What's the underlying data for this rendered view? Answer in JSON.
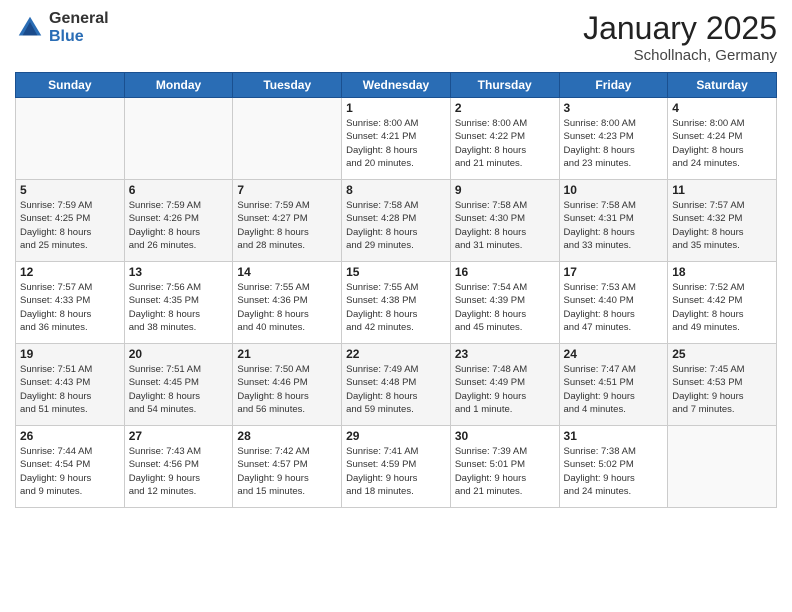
{
  "logo": {
    "general": "General",
    "blue": "Blue"
  },
  "header": {
    "title": "January 2025",
    "subtitle": "Schollnach, Germany"
  },
  "days_of_week": [
    "Sunday",
    "Monday",
    "Tuesday",
    "Wednesday",
    "Thursday",
    "Friday",
    "Saturday"
  ],
  "weeks": [
    [
      {
        "day": "",
        "info": ""
      },
      {
        "day": "",
        "info": ""
      },
      {
        "day": "",
        "info": ""
      },
      {
        "day": "1",
        "info": "Sunrise: 8:00 AM\nSunset: 4:21 PM\nDaylight: 8 hours\nand 20 minutes."
      },
      {
        "day": "2",
        "info": "Sunrise: 8:00 AM\nSunset: 4:22 PM\nDaylight: 8 hours\nand 21 minutes."
      },
      {
        "day": "3",
        "info": "Sunrise: 8:00 AM\nSunset: 4:23 PM\nDaylight: 8 hours\nand 23 minutes."
      },
      {
        "day": "4",
        "info": "Sunrise: 8:00 AM\nSunset: 4:24 PM\nDaylight: 8 hours\nand 24 minutes."
      }
    ],
    [
      {
        "day": "5",
        "info": "Sunrise: 7:59 AM\nSunset: 4:25 PM\nDaylight: 8 hours\nand 25 minutes."
      },
      {
        "day": "6",
        "info": "Sunrise: 7:59 AM\nSunset: 4:26 PM\nDaylight: 8 hours\nand 26 minutes."
      },
      {
        "day": "7",
        "info": "Sunrise: 7:59 AM\nSunset: 4:27 PM\nDaylight: 8 hours\nand 28 minutes."
      },
      {
        "day": "8",
        "info": "Sunrise: 7:58 AM\nSunset: 4:28 PM\nDaylight: 8 hours\nand 29 minutes."
      },
      {
        "day": "9",
        "info": "Sunrise: 7:58 AM\nSunset: 4:30 PM\nDaylight: 8 hours\nand 31 minutes."
      },
      {
        "day": "10",
        "info": "Sunrise: 7:58 AM\nSunset: 4:31 PM\nDaylight: 8 hours\nand 33 minutes."
      },
      {
        "day": "11",
        "info": "Sunrise: 7:57 AM\nSunset: 4:32 PM\nDaylight: 8 hours\nand 35 minutes."
      }
    ],
    [
      {
        "day": "12",
        "info": "Sunrise: 7:57 AM\nSunset: 4:33 PM\nDaylight: 8 hours\nand 36 minutes."
      },
      {
        "day": "13",
        "info": "Sunrise: 7:56 AM\nSunset: 4:35 PM\nDaylight: 8 hours\nand 38 minutes."
      },
      {
        "day": "14",
        "info": "Sunrise: 7:55 AM\nSunset: 4:36 PM\nDaylight: 8 hours\nand 40 minutes."
      },
      {
        "day": "15",
        "info": "Sunrise: 7:55 AM\nSunset: 4:38 PM\nDaylight: 8 hours\nand 42 minutes."
      },
      {
        "day": "16",
        "info": "Sunrise: 7:54 AM\nSunset: 4:39 PM\nDaylight: 8 hours\nand 45 minutes."
      },
      {
        "day": "17",
        "info": "Sunrise: 7:53 AM\nSunset: 4:40 PM\nDaylight: 8 hours\nand 47 minutes."
      },
      {
        "day": "18",
        "info": "Sunrise: 7:52 AM\nSunset: 4:42 PM\nDaylight: 8 hours\nand 49 minutes."
      }
    ],
    [
      {
        "day": "19",
        "info": "Sunrise: 7:51 AM\nSunset: 4:43 PM\nDaylight: 8 hours\nand 51 minutes."
      },
      {
        "day": "20",
        "info": "Sunrise: 7:51 AM\nSunset: 4:45 PM\nDaylight: 8 hours\nand 54 minutes."
      },
      {
        "day": "21",
        "info": "Sunrise: 7:50 AM\nSunset: 4:46 PM\nDaylight: 8 hours\nand 56 minutes."
      },
      {
        "day": "22",
        "info": "Sunrise: 7:49 AM\nSunset: 4:48 PM\nDaylight: 8 hours\nand 59 minutes."
      },
      {
        "day": "23",
        "info": "Sunrise: 7:48 AM\nSunset: 4:49 PM\nDaylight: 9 hours\nand 1 minute."
      },
      {
        "day": "24",
        "info": "Sunrise: 7:47 AM\nSunset: 4:51 PM\nDaylight: 9 hours\nand 4 minutes."
      },
      {
        "day": "25",
        "info": "Sunrise: 7:45 AM\nSunset: 4:53 PM\nDaylight: 9 hours\nand 7 minutes."
      }
    ],
    [
      {
        "day": "26",
        "info": "Sunrise: 7:44 AM\nSunset: 4:54 PM\nDaylight: 9 hours\nand 9 minutes."
      },
      {
        "day": "27",
        "info": "Sunrise: 7:43 AM\nSunset: 4:56 PM\nDaylight: 9 hours\nand 12 minutes."
      },
      {
        "day": "28",
        "info": "Sunrise: 7:42 AM\nSunset: 4:57 PM\nDaylight: 9 hours\nand 15 minutes."
      },
      {
        "day": "29",
        "info": "Sunrise: 7:41 AM\nSunset: 4:59 PM\nDaylight: 9 hours\nand 18 minutes."
      },
      {
        "day": "30",
        "info": "Sunrise: 7:39 AM\nSunset: 5:01 PM\nDaylight: 9 hours\nand 21 minutes."
      },
      {
        "day": "31",
        "info": "Sunrise: 7:38 AM\nSunset: 5:02 PM\nDaylight: 9 hours\nand 24 minutes."
      },
      {
        "day": "",
        "info": ""
      }
    ]
  ]
}
